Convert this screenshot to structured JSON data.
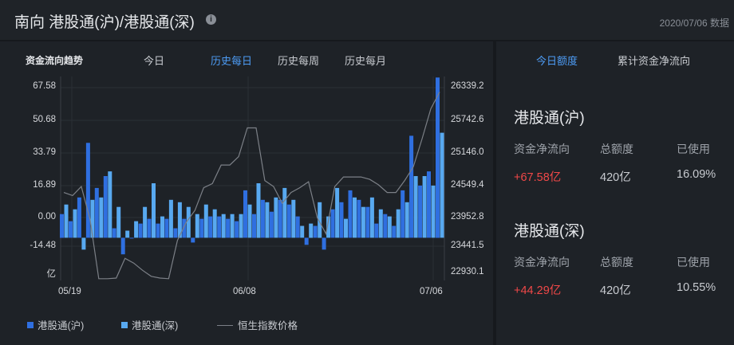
{
  "header": {
    "title": "南向 港股通(沪)/港股通(深)",
    "date": "2020/07/06 数据"
  },
  "left": {
    "title": "资金流向趋势",
    "tabs": [
      {
        "label": "今日",
        "active": false
      },
      {
        "label": "历史每日",
        "active": true
      },
      {
        "label": "历史每周",
        "active": false
      },
      {
        "label": "历史每月",
        "active": false
      }
    ],
    "legend": {
      "sh": "港股通(沪)",
      "sz": "港股通(深)",
      "index": "恒生指数价格"
    }
  },
  "chart_data": {
    "type": "bar",
    "y_left_ticks": [
      "67.58",
      "50.68",
      "33.79",
      "16.89",
      "0.00",
      "-14.48",
      "亿"
    ],
    "y_right_ticks": [
      "26339.2",
      "25742.6",
      "25146.0",
      "24549.4",
      "23952.8",
      "23441.5",
      "22930.1"
    ],
    "x_ticks": [
      "05/19",
      "06/08",
      "07/06"
    ],
    "ylim_left": [
      -18,
      68
    ],
    "ylim_right": [
      22930.1,
      26339.2
    ],
    "colors": {
      "sh": "#2f6fe0",
      "sz": "#58a9f0",
      "index": "#7c8087"
    },
    "series": [
      {
        "name": "港股通(沪)",
        "values": [
          10,
          7,
          17,
          40,
          21,
          26,
          4,
          -7,
          0,
          6,
          8,
          6,
          8,
          4,
          8,
          -2,
          8,
          9,
          9,
          8,
          7,
          20,
          10,
          16,
          11,
          16,
          14,
          9,
          -3,
          5,
          -5,
          12,
          15,
          20,
          16,
          13,
          6,
          10,
          5,
          20,
          43,
          22,
          28,
          67.58
        ]
      },
      {
        "name": "港股通(深)",
        "values": [
          14,
          12,
          -5,
          16,
          17,
          28,
          13,
          3,
          7,
          13,
          23,
          9,
          16,
          15,
          13,
          10,
          14,
          12,
          10,
          10,
          10,
          14,
          23,
          15,
          17,
          21,
          16,
          5,
          6,
          15,
          9,
          21,
          8,
          17,
          13,
          17,
          12,
          9,
          12,
          15,
          26,
          26,
          22,
          44.29
        ]
      },
      {
        "name": "恒生指数价格",
        "values": [
          24400,
          24350,
          24500,
          23950,
          22960,
          22960,
          22970,
          23300,
          23220,
          23100,
          23000,
          22970,
          22960,
          23600,
          23900,
          24100,
          24480,
          24550,
          24860,
          24860,
          25000,
          25480,
          25480,
          24600,
          24500,
          24220,
          24400,
          24480,
          24580,
          23980,
          23710,
          24500,
          24660,
          24660,
          24660,
          24620,
          24530,
          24400,
          24400,
          24600,
          24830,
          25300,
          25800,
          26080
        ]
      }
    ]
  },
  "right": {
    "tabs": [
      {
        "label": "今日额度",
        "active": true
      },
      {
        "label": "累计资金净流向",
        "active": false
      }
    ],
    "headers": [
      "资金净流向",
      "总额度",
      "已使用"
    ],
    "sh": {
      "name": "港股通(沪)",
      "net": "+67.58亿",
      "quota": "420亿",
      "used": "16.09%"
    },
    "sz": {
      "name": "港股通(深)",
      "net": "+44.29亿",
      "quota": "420亿",
      "used": "10.55%"
    }
  }
}
